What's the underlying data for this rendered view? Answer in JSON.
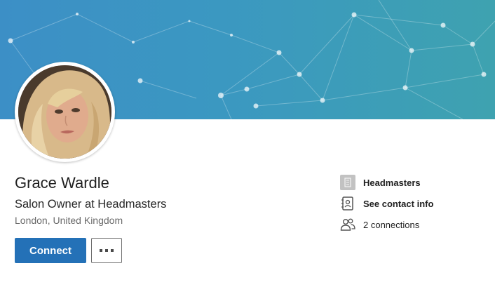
{
  "profile": {
    "name": "Grace Wardle",
    "headline": "Salon Owner at Headmasters",
    "location": "London, United Kingdom"
  },
  "actions": {
    "connect_label": "Connect",
    "more_icon": "more-horizontal-icon"
  },
  "sidebar": {
    "items": [
      {
        "icon": "company-logo-icon",
        "label": "Headmasters"
      },
      {
        "icon": "contact-card-icon",
        "label": "See contact info"
      },
      {
        "icon": "people-icon",
        "label": "2 connections"
      }
    ]
  },
  "colors": {
    "banner_start": "#3c8fc6",
    "banner_end": "#3ea2b0",
    "primary_button": "#2471b7"
  }
}
